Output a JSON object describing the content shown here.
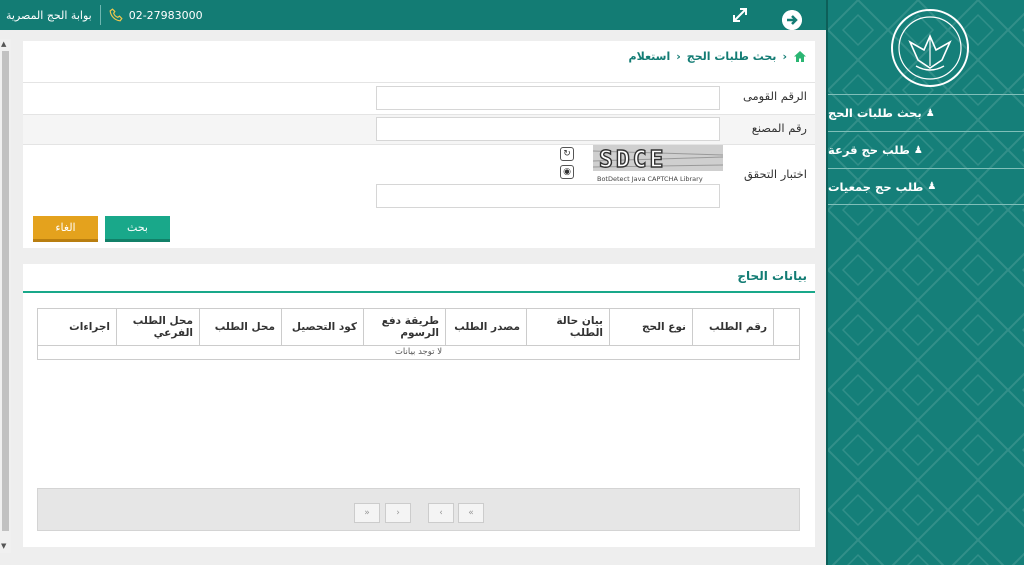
{
  "topbar": {
    "site_name": "بوابة الحج المصرية",
    "phone": "02-27983000"
  },
  "sidebar": {
    "items": [
      {
        "label": "بحث طلبات الحج"
      },
      {
        "label": "طلب حج قرعة"
      },
      {
        "label": "طلب حج جمعيات"
      }
    ]
  },
  "breadcrumb": {
    "items": [
      "بحث طلبات الحج",
      "استعلام"
    ]
  },
  "form": {
    "national_id_label": "الرقم القومى",
    "factory_no_label": "رقم المصنع",
    "captcha_label": "اختبار التحقق",
    "captcha_text": "SDCE",
    "captcha_caption": "BotDetect Java CAPTCHA Library",
    "search_button": "بحث",
    "cancel_button": "الغاء"
  },
  "results": {
    "title": "بيانات الحاج",
    "columns": [
      "رقم الطلب",
      "نوع الحج",
      "بيان حالة الطلب",
      "مصدر الطلب",
      "طريقة دفع الرسوم",
      "كود التحصيل",
      "محل الطلب",
      "محل الطلب الفرعي",
      "اجراءات"
    ],
    "empty_text": "لا توجد بيانات"
  },
  "pager": {
    "first": "«",
    "prev": "‹",
    "next": "›",
    "last": "»"
  },
  "colors": {
    "brand": "#137c74",
    "accent": "#19a88a",
    "cancel": "#e4a21d"
  }
}
